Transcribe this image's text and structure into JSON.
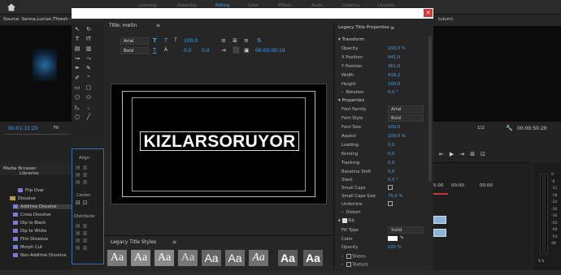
{
  "workspace_tabs": [
    "Learning",
    "Assembly",
    "Editing",
    "Color",
    "Effects",
    "Audio",
    "Graphics",
    "Libraries"
  ],
  "source_monitor": {
    "title": "Source: Senna,Lucian,Thresh - Le",
    "timecode": "00:01:15:25",
    "fit": "Fit"
  },
  "project": {
    "tabs": [
      "Media Browser",
      "Libraries"
    ],
    "items": [
      {
        "label": "Flip Over",
        "kind": "effect"
      },
      {
        "label": "Dissolve",
        "kind": "folder"
      },
      {
        "label": "Additive Dissolve",
        "kind": "effect"
      },
      {
        "label": "Cross Dissolve",
        "kind": "effect"
      },
      {
        "label": "Dip to Black",
        "kind": "effect"
      },
      {
        "label": "Dip to White",
        "kind": "effect"
      },
      {
        "label": "Film Dissolve",
        "kind": "effect"
      },
      {
        "label": "Morph Cut",
        "kind": "effect"
      },
      {
        "label": "Non-Additive Dissolve",
        "kind": "effect"
      }
    ]
  },
  "titler": {
    "tab_title": "Title: metin",
    "font": "Arial",
    "style": "Bold",
    "size": "100,0",
    "kerning": "0,0",
    "leading": "0,0",
    "tracking": "0,0",
    "timecode": "00:00:00:19",
    "text": "KIZLARSORUYOR",
    "align": {
      "title": "Align",
      "center": "Center",
      "distribute": "Distribute"
    },
    "styles": {
      "title": "Legacy Title Styles",
      "swatches": [
        "Aa",
        "Aa",
        "Aa",
        "Aa",
        "Aa",
        "Aa",
        "Aa",
        "Aa",
        "Aa"
      ]
    }
  },
  "properties": {
    "title": "Legacy Title Properties",
    "transform": "Transform",
    "rows": [
      {
        "label": "Opacity",
        "value": "100,0 %"
      },
      {
        "label": "X Position",
        "value": "641,0"
      },
      {
        "label": "Y Position",
        "value": "361,0"
      },
      {
        "label": "Width",
        "value": "918,2"
      },
      {
        "label": "Height",
        "value": "100,0"
      },
      {
        "label": "Rotation",
        "value": "0,0 °"
      }
    ],
    "properties_head": "Properties",
    "rows2": [
      {
        "label": "Font Family",
        "value": "Arial"
      },
      {
        "label": "Font Style",
        "value": "Bold"
      },
      {
        "label": "Font Size",
        "value": "100,0"
      },
      {
        "label": "Aspect",
        "value": "100,0 %"
      },
      {
        "label": "Leading",
        "value": "0,0"
      },
      {
        "label": "Kerning",
        "value": "0,0"
      },
      {
        "label": "Tracking",
        "value": "0,0"
      },
      {
        "label": "Baseline Shift",
        "value": "0,0"
      },
      {
        "label": "Slant",
        "value": "0,0 °"
      },
      {
        "label": "Small Caps",
        "value": ""
      },
      {
        "label": "Small Caps Size",
        "value": "75,0 %"
      },
      {
        "label": "Underline",
        "value": ""
      },
      {
        "label": "Distort",
        "value": ""
      }
    ],
    "fill": "Fill",
    "fill_rows": [
      {
        "label": "Fill Type",
        "value": "Solid"
      },
      {
        "label": "Color",
        "value": ""
      },
      {
        "label": "Opacity",
        "value": "100 %"
      }
    ],
    "sheen": "Sheen",
    "texture": "Texture"
  },
  "program_monitor": {
    "title": "tulum)",
    "timecode": "00:00:50:20",
    "zoom": "1/2"
  },
  "timeline": {
    "time": "5:00",
    "marks": [
      "00:00",
      "00:00"
    ]
  },
  "meter": {
    "labels": [
      "0",
      "-6",
      "-12",
      "-18",
      "-24",
      "-30",
      "-36",
      "-42",
      "-48",
      "-54",
      "dB"
    ],
    "foot": "S  S"
  },
  "colors": {
    "accent": "#4aa3e8",
    "close": "#d23b3b"
  }
}
